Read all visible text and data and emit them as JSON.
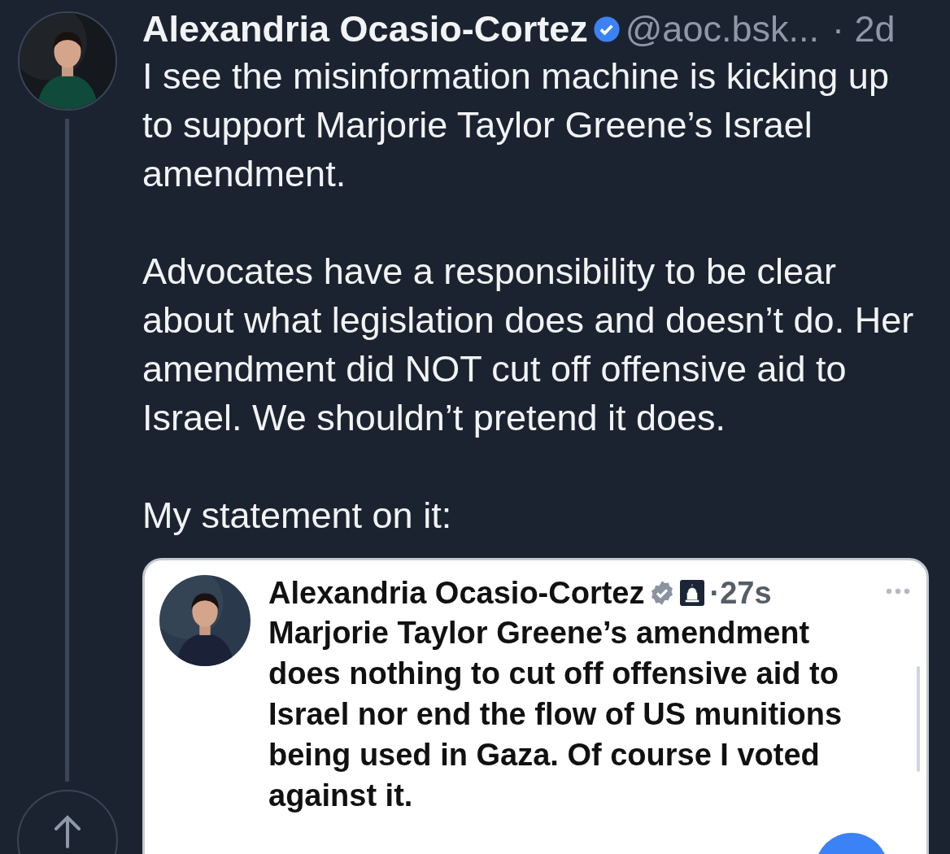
{
  "post": {
    "author": "Alexandria Ocasio-Cortez",
    "verified": true,
    "handle": "@aoc.bsk...",
    "time": "· 2d",
    "paragraphs": [
      "I see the misinformation machine is kicking up to support Marjorie Taylor Greene’s Israel amendment.",
      "Advocates have a responsibility to be clear about what legislation does and doesn’t do. Her amendment did NOT cut off offensive aid to Israel. We shouldn’t pretend it does.",
      "My statement on it:"
    ],
    "quote": {
      "author": "Alexandria Ocasio-Cortez",
      "verified": true,
      "time": "·27s",
      "text": "Marjorie Taylor Greene’s amendment does nothing to cut off offensive aid to Israel nor end the flow of US munitions being used in Gaza. Of course I voted against it."
    }
  }
}
